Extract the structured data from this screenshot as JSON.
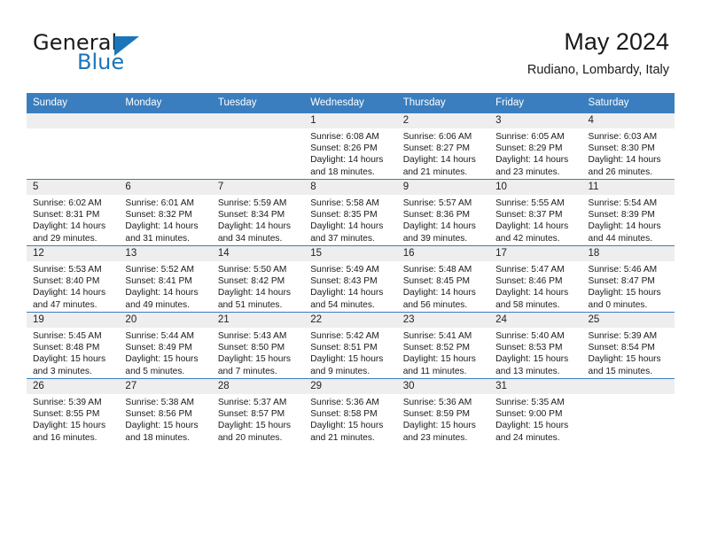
{
  "brand": {
    "word1": "General",
    "word2": "Blue",
    "triangle_color": "#1b75bb"
  },
  "header": {
    "title": "May 2024",
    "subtitle": "Rudiano, Lombardy, Italy",
    "accent_color": "#3a7ebf",
    "daynum_band_color": "#eeeeee"
  },
  "weekday_headers": [
    "Sunday",
    "Monday",
    "Tuesday",
    "Wednesday",
    "Thursday",
    "Friday",
    "Saturday"
  ],
  "labels": {
    "sunrise_prefix": "Sunrise:",
    "sunset_prefix": "Sunset:",
    "daylight_prefix": "Daylight:"
  },
  "weeks": [
    [
      {
        "day": "",
        "lines": []
      },
      {
        "day": "",
        "lines": []
      },
      {
        "day": "",
        "lines": []
      },
      {
        "day": "1",
        "lines": [
          "Sunrise: 6:08 AM",
          "Sunset: 8:26 PM",
          "Daylight: 14 hours",
          "and 18 minutes."
        ]
      },
      {
        "day": "2",
        "lines": [
          "Sunrise: 6:06 AM",
          "Sunset: 8:27 PM",
          "Daylight: 14 hours",
          "and 21 minutes."
        ]
      },
      {
        "day": "3",
        "lines": [
          "Sunrise: 6:05 AM",
          "Sunset: 8:29 PM",
          "Daylight: 14 hours",
          "and 23 minutes."
        ]
      },
      {
        "day": "4",
        "lines": [
          "Sunrise: 6:03 AM",
          "Sunset: 8:30 PM",
          "Daylight: 14 hours",
          "and 26 minutes."
        ]
      }
    ],
    [
      {
        "day": "5",
        "lines": [
          "Sunrise: 6:02 AM",
          "Sunset: 8:31 PM",
          "Daylight: 14 hours",
          "and 29 minutes."
        ]
      },
      {
        "day": "6",
        "lines": [
          "Sunrise: 6:01 AM",
          "Sunset: 8:32 PM",
          "Daylight: 14 hours",
          "and 31 minutes."
        ]
      },
      {
        "day": "7",
        "lines": [
          "Sunrise: 5:59 AM",
          "Sunset: 8:34 PM",
          "Daylight: 14 hours",
          "and 34 minutes."
        ]
      },
      {
        "day": "8",
        "lines": [
          "Sunrise: 5:58 AM",
          "Sunset: 8:35 PM",
          "Daylight: 14 hours",
          "and 37 minutes."
        ]
      },
      {
        "day": "9",
        "lines": [
          "Sunrise: 5:57 AM",
          "Sunset: 8:36 PM",
          "Daylight: 14 hours",
          "and 39 minutes."
        ]
      },
      {
        "day": "10",
        "lines": [
          "Sunrise: 5:55 AM",
          "Sunset: 8:37 PM",
          "Daylight: 14 hours",
          "and 42 minutes."
        ]
      },
      {
        "day": "11",
        "lines": [
          "Sunrise: 5:54 AM",
          "Sunset: 8:39 PM",
          "Daylight: 14 hours",
          "and 44 minutes."
        ]
      }
    ],
    [
      {
        "day": "12",
        "lines": [
          "Sunrise: 5:53 AM",
          "Sunset: 8:40 PM",
          "Daylight: 14 hours",
          "and 47 minutes."
        ]
      },
      {
        "day": "13",
        "lines": [
          "Sunrise: 5:52 AM",
          "Sunset: 8:41 PM",
          "Daylight: 14 hours",
          "and 49 minutes."
        ]
      },
      {
        "day": "14",
        "lines": [
          "Sunrise: 5:50 AM",
          "Sunset: 8:42 PM",
          "Daylight: 14 hours",
          "and 51 minutes."
        ]
      },
      {
        "day": "15",
        "lines": [
          "Sunrise: 5:49 AM",
          "Sunset: 8:43 PM",
          "Daylight: 14 hours",
          "and 54 minutes."
        ]
      },
      {
        "day": "16",
        "lines": [
          "Sunrise: 5:48 AM",
          "Sunset: 8:45 PM",
          "Daylight: 14 hours",
          "and 56 minutes."
        ]
      },
      {
        "day": "17",
        "lines": [
          "Sunrise: 5:47 AM",
          "Sunset: 8:46 PM",
          "Daylight: 14 hours",
          "and 58 minutes."
        ]
      },
      {
        "day": "18",
        "lines": [
          "Sunrise: 5:46 AM",
          "Sunset: 8:47 PM",
          "Daylight: 15 hours",
          "and 0 minutes."
        ]
      }
    ],
    [
      {
        "day": "19",
        "lines": [
          "Sunrise: 5:45 AM",
          "Sunset: 8:48 PM",
          "Daylight: 15 hours",
          "and 3 minutes."
        ]
      },
      {
        "day": "20",
        "lines": [
          "Sunrise: 5:44 AM",
          "Sunset: 8:49 PM",
          "Daylight: 15 hours",
          "and 5 minutes."
        ]
      },
      {
        "day": "21",
        "lines": [
          "Sunrise: 5:43 AM",
          "Sunset: 8:50 PM",
          "Daylight: 15 hours",
          "and 7 minutes."
        ]
      },
      {
        "day": "22",
        "lines": [
          "Sunrise: 5:42 AM",
          "Sunset: 8:51 PM",
          "Daylight: 15 hours",
          "and 9 minutes."
        ]
      },
      {
        "day": "23",
        "lines": [
          "Sunrise: 5:41 AM",
          "Sunset: 8:52 PM",
          "Daylight: 15 hours",
          "and 11 minutes."
        ]
      },
      {
        "day": "24",
        "lines": [
          "Sunrise: 5:40 AM",
          "Sunset: 8:53 PM",
          "Daylight: 15 hours",
          "and 13 minutes."
        ]
      },
      {
        "day": "25",
        "lines": [
          "Sunrise: 5:39 AM",
          "Sunset: 8:54 PM",
          "Daylight: 15 hours",
          "and 15 minutes."
        ]
      }
    ],
    [
      {
        "day": "26",
        "lines": [
          "Sunrise: 5:39 AM",
          "Sunset: 8:55 PM",
          "Daylight: 15 hours",
          "and 16 minutes."
        ]
      },
      {
        "day": "27",
        "lines": [
          "Sunrise: 5:38 AM",
          "Sunset: 8:56 PM",
          "Daylight: 15 hours",
          "and 18 minutes."
        ]
      },
      {
        "day": "28",
        "lines": [
          "Sunrise: 5:37 AM",
          "Sunset: 8:57 PM",
          "Daylight: 15 hours",
          "and 20 minutes."
        ]
      },
      {
        "day": "29",
        "lines": [
          "Sunrise: 5:36 AM",
          "Sunset: 8:58 PM",
          "Daylight: 15 hours",
          "and 21 minutes."
        ]
      },
      {
        "day": "30",
        "lines": [
          "Sunrise: 5:36 AM",
          "Sunset: 8:59 PM",
          "Daylight: 15 hours",
          "and 23 minutes."
        ]
      },
      {
        "day": "31",
        "lines": [
          "Sunrise: 5:35 AM",
          "Sunset: 9:00 PM",
          "Daylight: 15 hours",
          "and 24 minutes."
        ]
      },
      {
        "day": "",
        "lines": []
      }
    ]
  ]
}
